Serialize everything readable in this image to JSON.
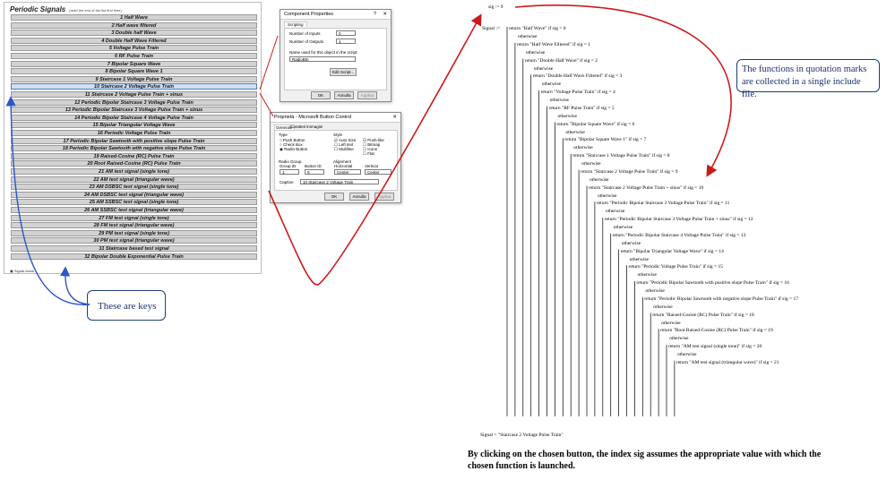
{
  "panel": {
    "title": "Periodic Signals",
    "subtitle": "(read the end of the list first time)",
    "selected_index": 9,
    "keys": [
      "1 Half Wave",
      "2 Half wave filtered",
      "3 Double half Wave",
      "4 Double Half Wave Filtered",
      "5 Voltage Pulse Train",
      "6 RF Pulse Train",
      "7 Bipolar Square Wave",
      "8 Bipolar Square Wave 1",
      "9 Staircase 1 Voltage Pulse Train",
      "10 Staircase 2 Voltage Pulse Train",
      "11 Staircase 2 Voltage  Pulse Train + sinus",
      "12 Periodic Bipolar  Staircase 3 Voltage Pulse Train",
      "13 Periodic Bipolar Staircase 3 Voltage Pulse Train + sinus",
      "14 Periodic Bipolar Staircase 4 Voltage Pulse Train",
      "15 Bipolar Triangular Voltage Wave",
      "16 Periodic Voltage  Pulse Train",
      "17 Periodic Bipolar Sawtooth with positive slope   Pulse Train",
      "18 Periodic Bipolar  Sawtooth with negative slope   Pulse Train",
      "19 Raised-Cosine (RC) Pulse Train",
      "20 Root Raised-Cosine (RC) Pulse Train",
      "21 AM test signal (single tone)",
      "22 AM test signal  (triangular wave)",
      "23 AM DSBSC test signal (single tone)",
      "24 AM DSBSC test signal (triangular wave)",
      "25 AM SSBSC test signal (single tone)",
      "26 AM SSBSC test signal (triangular wave)",
      "27 FM test signal (single tone)",
      "28 FM test signal (triangular wave)",
      "29 PM test signal (single tone)",
      "30 PM test signal (triangular wave)",
      "31 Staircase based test signal",
      "32 Bipolar Double Exponential Pulse Train"
    ],
    "status": "Signal name"
  },
  "component_properties": {
    "title": "Component Properties",
    "help": "?",
    "close": "✕",
    "tab": "Scripting",
    "inputs_label": "Number of Inputs",
    "inputs_value": "0",
    "outputs_label": "Number of Outputs",
    "outputs_value": "1",
    "name_label": "Name used for this object in the script:",
    "name_value": "RadioBtn",
    "edit_script": "Edit Script...",
    "ok": "OK",
    "cancel": "Annulla",
    "apply": "Applica"
  },
  "button_properties": {
    "title": "Proprietà - Microsoft Button Control",
    "close": "✕",
    "tabs": [
      "Generale",
      "Caratteri",
      "Immagini"
    ],
    "type_label": "Type",
    "type_options": [
      "Push Button",
      "Check Box",
      "Radio Button"
    ],
    "style_label": "Style",
    "style_options": [
      "Auto Size",
      "Left text",
      "Multiline"
    ],
    "style_options2": [
      "Push-like",
      "Bitmap",
      "Icons",
      "Flat"
    ],
    "radio_group_label": "Radio Group",
    "group_id_label": "Group ID",
    "group_id_value": "1",
    "button_id_label": "Button ID",
    "button_id_value": "9",
    "alignment_label": "Alignment",
    "horizontal_label": "Horizontal",
    "horizontal_value": "Center",
    "vertical_label": "Vertical",
    "vertical_value": "Center",
    "caption_label": "Caption",
    "caption_value": "10 Staircase 2 Voltage Train",
    "ok": "OK",
    "cancel": "Annulla",
    "apply": "Applica"
  },
  "formula": {
    "sig_assign": "sig := 9",
    "signal_def": "Signal :=",
    "otherwise": "otherwise",
    "cases": [
      [
        "Half Wave",
        0
      ],
      [
        "Half Wave Filtered",
        1
      ],
      [
        "Double Half Wave",
        2
      ],
      [
        "Double Half Wave Filtered",
        3
      ],
      [
        "Voltage Pulse Train",
        4
      ],
      [
        "RF Pulse Train",
        5
      ],
      [
        "Bipolar Square Wave",
        6
      ],
      [
        "Bipolar Square Wave 1",
        7
      ],
      [
        "Staircase 1 Voltage  Pulse  Train",
        8
      ],
      [
        "Staircase 2 Voltage  Pulse  Train",
        9
      ],
      [
        "Staircase 2 Voltage  Pulse Train + sinus",
        10
      ],
      [
        "Periodic Bipolar  Staircase 3 Voltage Pulse Train",
        11
      ],
      [
        "Periodic Bipolar Staircase 3 Voltage Pulse Train + sinus",
        12
      ],
      [
        "Periodic Bipolar Staircase 4 Voltage Pulse Train",
        13
      ],
      [
        "Bipolar Triangular Voltage Wave",
        14
      ],
      [
        "Periodic  Voltage Pulse Train",
        15
      ],
      [
        "Periodic Bipolar Sawtooth with positive slope  Pulse Train",
        16
      ],
      [
        "Periodic Bipolar  Sawtooth with negative slope  Pulse Train",
        17
      ],
      [
        "Raised-Cosine (RC) Pulse Train",
        18
      ],
      [
        "Root Raised-Cosine (RC) Pulse Train",
        19
      ],
      [
        "AM test signal  (single tone)",
        20
      ],
      [
        "AM test signal  (triangular wave)",
        21
      ]
    ],
    "result": "Signal = \"Staircase 2 Voltage  Pulse  Train\""
  },
  "annotations": {
    "include_note": "The functions in quotation marks are collected in a single include file.",
    "keys_note": "These are keys",
    "caption": "By clicking on the chosen button, the index sig assumes the appropriate value with which the chosen function is launched."
  },
  "colors": {
    "arrow_red": "#cc1a1a",
    "arrow_blue": "#2f55c8",
    "callout_text": "#1b2f6e",
    "key_bg": "#d2d2d2",
    "key_selected_bg": "#cfe0f3"
  }
}
